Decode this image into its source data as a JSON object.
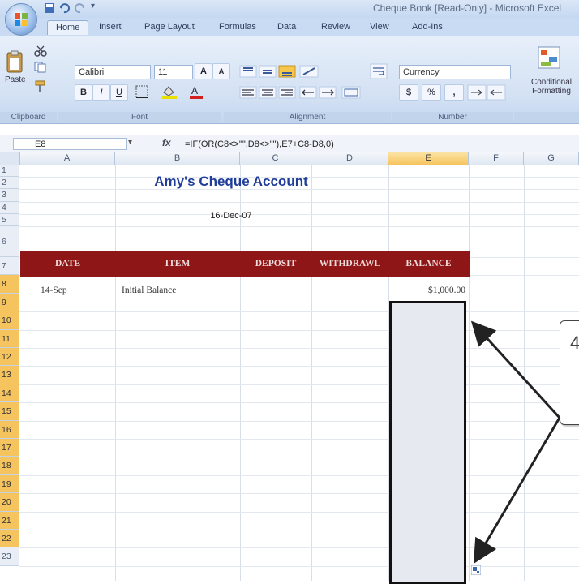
{
  "window": {
    "title": "Cheque Book [Read-Only] - Microsoft Excel"
  },
  "tabs": [
    "Home",
    "Insert",
    "Page Layout",
    "Formulas",
    "Data",
    "Review",
    "View",
    "Add-Ins"
  ],
  "ribbon": {
    "clipboard": {
      "paste_label": "Paste",
      "group_label": "Clipboard"
    },
    "font": {
      "name": "Calibri",
      "size": "11",
      "group_label": "Font"
    },
    "alignment": {
      "group_label": "Alignment"
    },
    "number": {
      "format": "Currency",
      "currency_symbol": "$",
      "percent": "%",
      "comma": ",",
      "group_label": "Number"
    },
    "styles": {
      "conditional_formatting": "Conditional Formatting"
    }
  },
  "formula_bar": {
    "name_box": "E8",
    "fx_label": "fx",
    "formula": "=IF(OR(C8<>\"\",D8<>\"\"),E7+C8-D8,0)"
  },
  "grid": {
    "columns": [
      "A",
      "B",
      "C",
      "D",
      "E",
      "F",
      "G"
    ],
    "selected_column": "E",
    "rows": [
      "1",
      "2",
      "3",
      "4",
      "5",
      "6",
      "7",
      "8",
      "9",
      "10",
      "11",
      "12",
      "13",
      "14",
      "15",
      "16",
      "17",
      "18",
      "19",
      "20",
      "21",
      "22",
      "23"
    ]
  },
  "sheet": {
    "title": "Amy's Cheque Account",
    "date": "16-Dec-07",
    "headers": [
      "DATE",
      "ITEM",
      "DEPOSIT",
      "WITHDRAWL",
      "BALANCE"
    ],
    "row7": {
      "date": "14-Sep",
      "item": "Initial Balance",
      "balance": "$1,000.00"
    },
    "header_color": "#8e1616",
    "title_color": "#1f3d99"
  },
  "callout": {
    "number": "4"
  },
  "colors": {
    "selected_header": "#f6c45e",
    "ribbon_bg": "#dbe7f7"
  }
}
